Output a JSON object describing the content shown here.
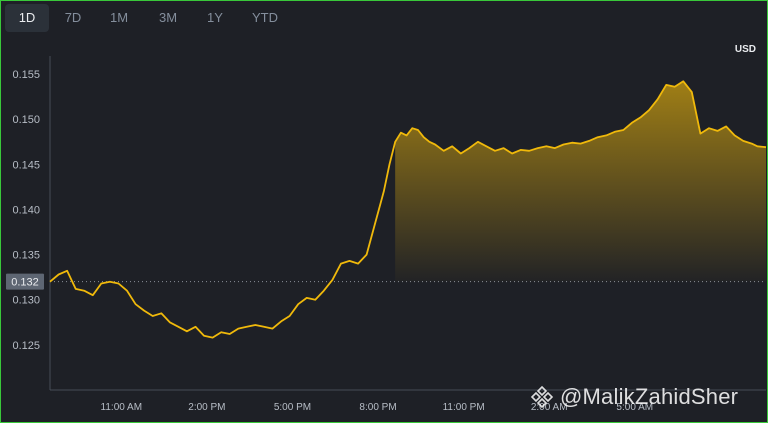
{
  "tabs": [
    "1D",
    "7D",
    "1M",
    "3M",
    "1Y",
    "YTD"
  ],
  "active_tab": "1D",
  "currency": "USD",
  "current_price_label": "0.132",
  "watermark": "@MalikZahidSher",
  "colors": {
    "line": "#f0b90b",
    "background": "#1e2026",
    "axis_text": "#b7bdc6",
    "frame": "#39c83a"
  },
  "chart_data": {
    "type": "area",
    "title": "",
    "xlabel": "",
    "ylabel": "",
    "ylim": [
      0.12,
      0.157
    ],
    "y_ticks": [
      "0.155",
      "0.150",
      "0.145",
      "0.140",
      "0.135",
      "0.130",
      "0.125"
    ],
    "x_ticks": [
      {
        "label": "11:00 AM",
        "x": 11
      },
      {
        "label": "2:00 PM",
        "x": 14
      },
      {
        "label": "5:00 PM",
        "x": 17
      },
      {
        "label": "8:00 PM",
        "x": 20
      },
      {
        "label": "11:00 PM",
        "x": 23
      },
      {
        "label": "2:00 AM",
        "x": 26
      },
      {
        "label": "5:00 AM",
        "x": 29
      }
    ],
    "xlim": [
      8.5,
      33.6
    ],
    "reference_line": 0.132,
    "highlight_start_x": 20.5,
    "x": [
      8.5,
      8.8,
      9.1,
      9.4,
      9.7,
      10.0,
      10.3,
      10.6,
      10.9,
      11.2,
      11.5,
      11.8,
      12.1,
      12.4,
      12.7,
      13.0,
      13.3,
      13.6,
      13.9,
      14.2,
      14.5,
      14.8,
      15.1,
      15.4,
      15.7,
      16.0,
      16.3,
      16.6,
      16.9,
      17.2,
      17.5,
      17.8,
      18.1,
      18.4,
      18.7,
      19.0,
      19.3,
      19.6,
      19.9,
      20.2,
      20.4,
      20.6,
      20.8,
      21.0,
      21.2,
      21.4,
      21.6,
      21.8,
      22.0,
      22.3,
      22.6,
      22.9,
      23.2,
      23.5,
      23.8,
      24.1,
      24.4,
      24.7,
      25.0,
      25.3,
      25.6,
      25.9,
      26.2,
      26.5,
      26.8,
      27.1,
      27.4,
      27.7,
      28.0,
      28.3,
      28.6,
      28.9,
      29.2,
      29.5,
      29.8,
      30.1,
      30.4,
      30.7,
      31.0,
      31.3,
      31.6,
      31.9,
      32.2,
      32.5,
      32.8,
      33.1,
      33.3,
      33.6
    ],
    "values": [
      0.132,
      0.1328,
      0.1332,
      0.1312,
      0.131,
      0.1305,
      0.1318,
      0.132,
      0.1318,
      0.131,
      0.1295,
      0.1288,
      0.1282,
      0.1285,
      0.1275,
      0.127,
      0.1265,
      0.127,
      0.126,
      0.1258,
      0.1264,
      0.1262,
      0.1268,
      0.127,
      0.1272,
      0.127,
      0.1268,
      0.1276,
      0.1282,
      0.1295,
      0.1302,
      0.13,
      0.131,
      0.1322,
      0.134,
      0.1343,
      0.134,
      0.135,
      0.1385,
      0.142,
      0.145,
      0.1475,
      0.1485,
      0.1482,
      0.149,
      0.1488,
      0.148,
      0.1475,
      0.1472,
      0.1465,
      0.147,
      0.1462,
      0.1468,
      0.1475,
      0.147,
      0.1465,
      0.1468,
      0.1462,
      0.1466,
      0.1465,
      0.1468,
      0.147,
      0.1468,
      0.1472,
      0.1474,
      0.1473,
      0.1476,
      0.148,
      0.1482,
      0.1486,
      0.1488,
      0.1496,
      0.1502,
      0.151,
      0.1522,
      0.1538,
      0.1536,
      0.1542,
      0.153,
      0.1484,
      0.149,
      0.1487,
      0.1492,
      0.1482,
      0.1476,
      0.1473,
      0.147,
      0.1469
    ]
  }
}
